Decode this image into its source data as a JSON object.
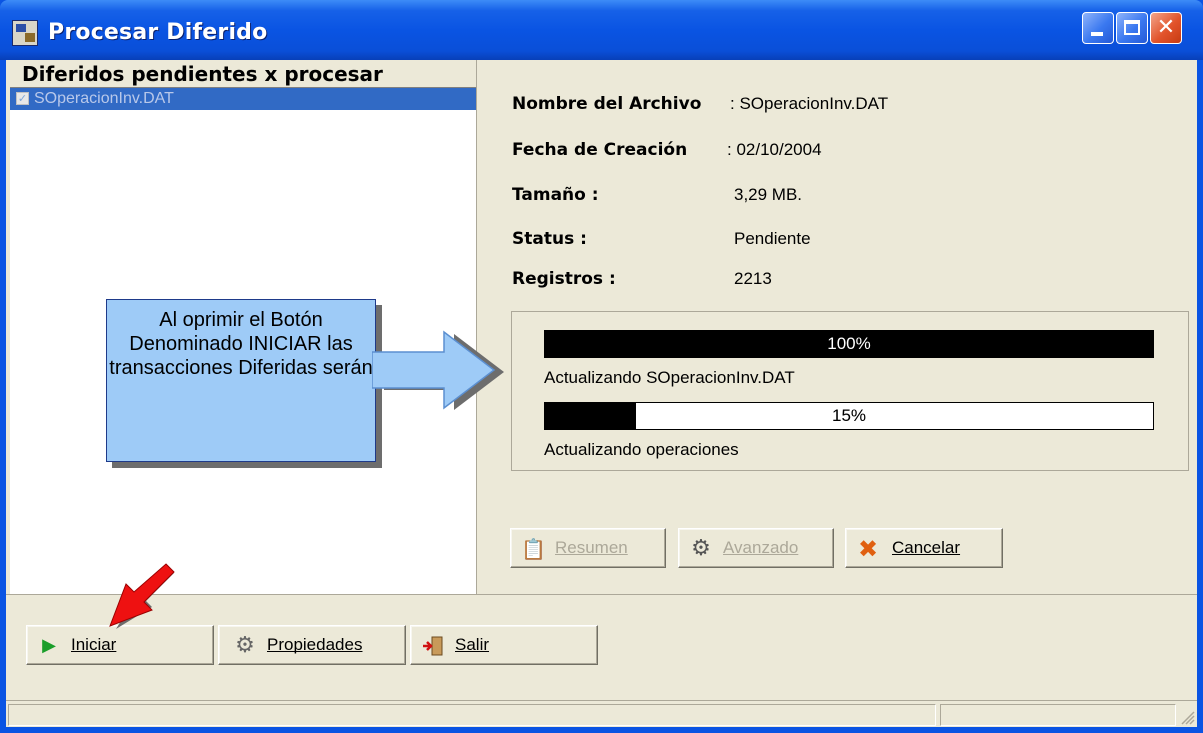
{
  "window": {
    "title": "Procesar Diferido",
    "controls": [
      "minimize-icon",
      "maximize-icon",
      "close-icon"
    ],
    "colors": {
      "titlebar": "#0a54e3",
      "close": "#e2542b",
      "face": "#ece9d8",
      "selection": "#316ac5"
    }
  },
  "left_panel": {
    "header": "Diferidos pendientes x procesar",
    "items": [
      {
        "label": "SOperacionInv.DAT",
        "checked": true,
        "selected": true
      }
    ]
  },
  "details": {
    "file_name_label": "Nombre del Archivo",
    "file_name_value": ": SOperacionInv.DAT",
    "created_label": "Fecha de Creación",
    "created_value": ": 02/10/2004",
    "size_label": "Tamaño :",
    "size_value": "3,29 MB.",
    "status_label": "Status :",
    "status_value": "Pendiente",
    "records_label": "Registros :",
    "records_value": "2213"
  },
  "progress": {
    "file": {
      "percent": 100,
      "percent_text": "100%",
      "label": "Actualizando SOperacionInv.DAT"
    },
    "ops": {
      "percent": 15,
      "percent_text": "15%",
      "label": "Actualizando operaciones"
    }
  },
  "action_buttons": {
    "resumen": {
      "label": "Resumen",
      "enabled": false,
      "icon": "clipboard-icon"
    },
    "avanzado": {
      "label": "Avanzado",
      "enabled": false,
      "icon": "gear-icon"
    },
    "cancelar": {
      "label": "Cancelar",
      "enabled": true,
      "icon": "red-x-icon"
    }
  },
  "bottom_buttons": {
    "iniciar": {
      "label": "Iniciar",
      "icon": "play-icon"
    },
    "propiedades": {
      "label": "Propiedades",
      "icon": "gear-icon"
    },
    "salir": {
      "label": "Salir",
      "icon": "exit-door-icon"
    }
  },
  "annotation": {
    "callout_text": "Al oprimir el Botón Denominado INICIAR las transacciones Diferidas serán"
  }
}
